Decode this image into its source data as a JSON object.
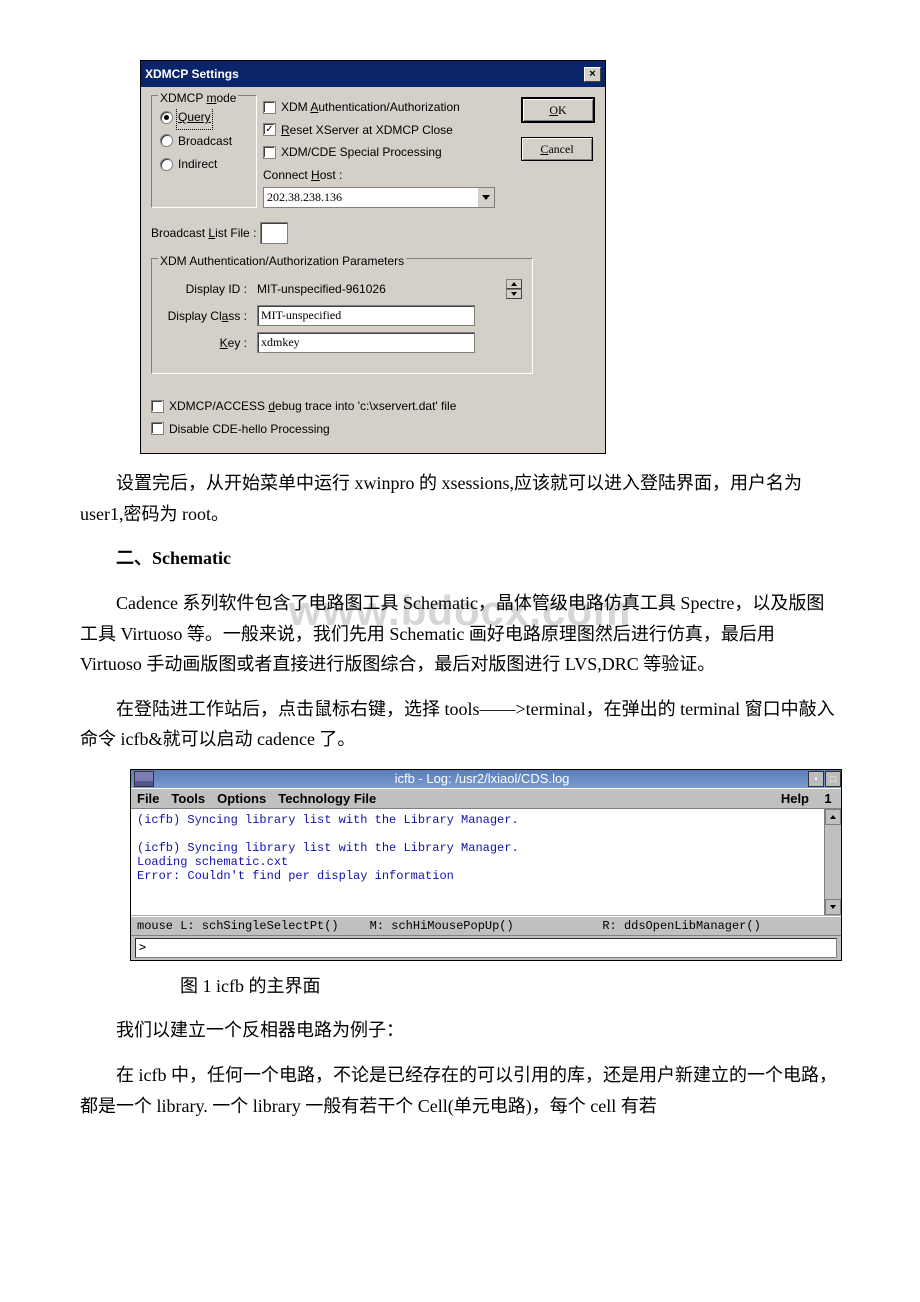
{
  "dialog": {
    "title": "XDMCP Settings",
    "mode_group_label": "XDMCP mode",
    "mode": {
      "query": "Query",
      "broadcast": "Broadcast",
      "indirect": "Indirect"
    },
    "chk": {
      "xdm_auth": "XDM Authentication/Authorization",
      "reset": "Reset XServer at XDMCP Close",
      "special": "XDM/CDE Special Processing"
    },
    "connect_host_label": "Connect Host :",
    "host_value": "202.38.238.136",
    "buttons": {
      "ok": "OK",
      "cancel": "Cancel"
    },
    "broadcast_file_label": "Broadcast List File :",
    "auth_group_label": "XDM Authentication/Authorization Parameters",
    "display_id_label": "Display ID :",
    "display_id_value": "MIT-unspecified-961026",
    "display_class_label": "Display Class :",
    "display_class_value": "MIT-unspecified",
    "key_label": "Key :",
    "key_value": "xdmkey",
    "debug_trace": "XDMCP/ACCESS debug trace into 'c:\\xservert.dat' file",
    "disable_cde": "Disable CDE-hello Processing"
  },
  "watermark": "www.bdocx.com",
  "text": {
    "p1": "设置完后，从开始菜单中运行 xwinpro 的 xsessions,应该就可以进入登陆界面，用户名为 user1,密码为 root。",
    "h2": "二、Schematic",
    "p2": "Cadence 系列软件包含了电路图工具 Schematic，晶体管级电路仿真工具 Spectre，以及版图工具 Virtuoso 等。一般来说，我们先用 Schematic 画好电路原理图然后进行仿真，最后用 Virtuoso 手动画版图或者直接进行版图综合，最后对版图进行 LVS,DRC 等验证。",
    "p3": "在登陆进工作站后，点击鼠标右键，选择 tools——>terminal，在弹出的 terminal 窗口中敲入命令 icfb&就可以启动 cadence 了。",
    "caption": "图 1 icfb 的主界面",
    "p4": "我们以建立一个反相器电路为例子：",
    "p5": "在 icfb 中，任何一个电路，不论是已经存在的可以引用的库，还是用户新建立的一个电路，都是一个 library. 一个 library 一般有若干个 Cell(单元电路)，每个 cell 有若"
  },
  "icfb": {
    "title": "icfb - Log: /usr2/lxiaol/CDS.log",
    "menu": {
      "file": "File",
      "tools": "Tools",
      "options": "Options",
      "tech": "Technology File",
      "help": "Help",
      "one": "1"
    },
    "log_lines": [
      "(icfb) Syncing library list with the Library Manager.",
      "",
      "(icfb) Syncing library list with the Library Manager.",
      "Loading schematic.cxt",
      "Error: Couldn't find per display information"
    ],
    "status": {
      "l": "mouse L: schSingleSelectPt()",
      "m": "M: schHiMousePopUp()",
      "r": "R: ddsOpenLibManager()"
    },
    "prompt": ">"
  }
}
